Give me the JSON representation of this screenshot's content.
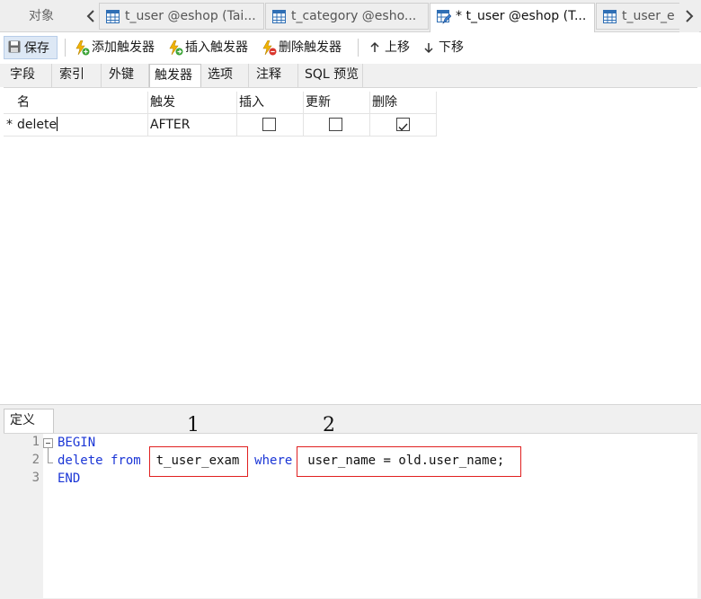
{
  "tabbar": {
    "objects_label": "对象",
    "tabs": [
      {
        "label": "t_user @eshop (Tai..."
      },
      {
        "label": "t_category @esho..."
      },
      {
        "label": "* t_user @eshop (T..."
      },
      {
        "label": "t_user_e"
      }
    ]
  },
  "toolbar": {
    "save": "保存",
    "add_trigger": "添加触发器",
    "insert_trigger": "插入触发器",
    "delete_trigger": "删除触发器",
    "move_up": "上移",
    "move_down": "下移"
  },
  "designer_tabs": [
    "字段",
    "索引",
    "外键",
    "触发器",
    "选项",
    "注释",
    "SQL 预览"
  ],
  "grid": {
    "headers": [
      "名",
      "触发",
      "插入",
      "更新",
      "删除"
    ],
    "rows": [
      {
        "marker": "*",
        "name": "delete",
        "fire": "AFTER",
        "insert": false,
        "update": false,
        "delete": true
      }
    ]
  },
  "definition": {
    "tab_label": "定义",
    "line_numbers": [
      "1",
      "2",
      "3"
    ],
    "code": {
      "begin": "BEGIN",
      "kw_delete": "delete",
      "kw_from": "from",
      "table": "t_user_exam",
      "kw_where": "where",
      "condition": "user_name = old.user_name;",
      "end": "END"
    },
    "annotations": [
      "1",
      "2"
    ]
  },
  "colors": {
    "keyword": "#1b36d6",
    "highlight_box": "#e02020",
    "active_toolbar_button": "#dde8f5"
  }
}
